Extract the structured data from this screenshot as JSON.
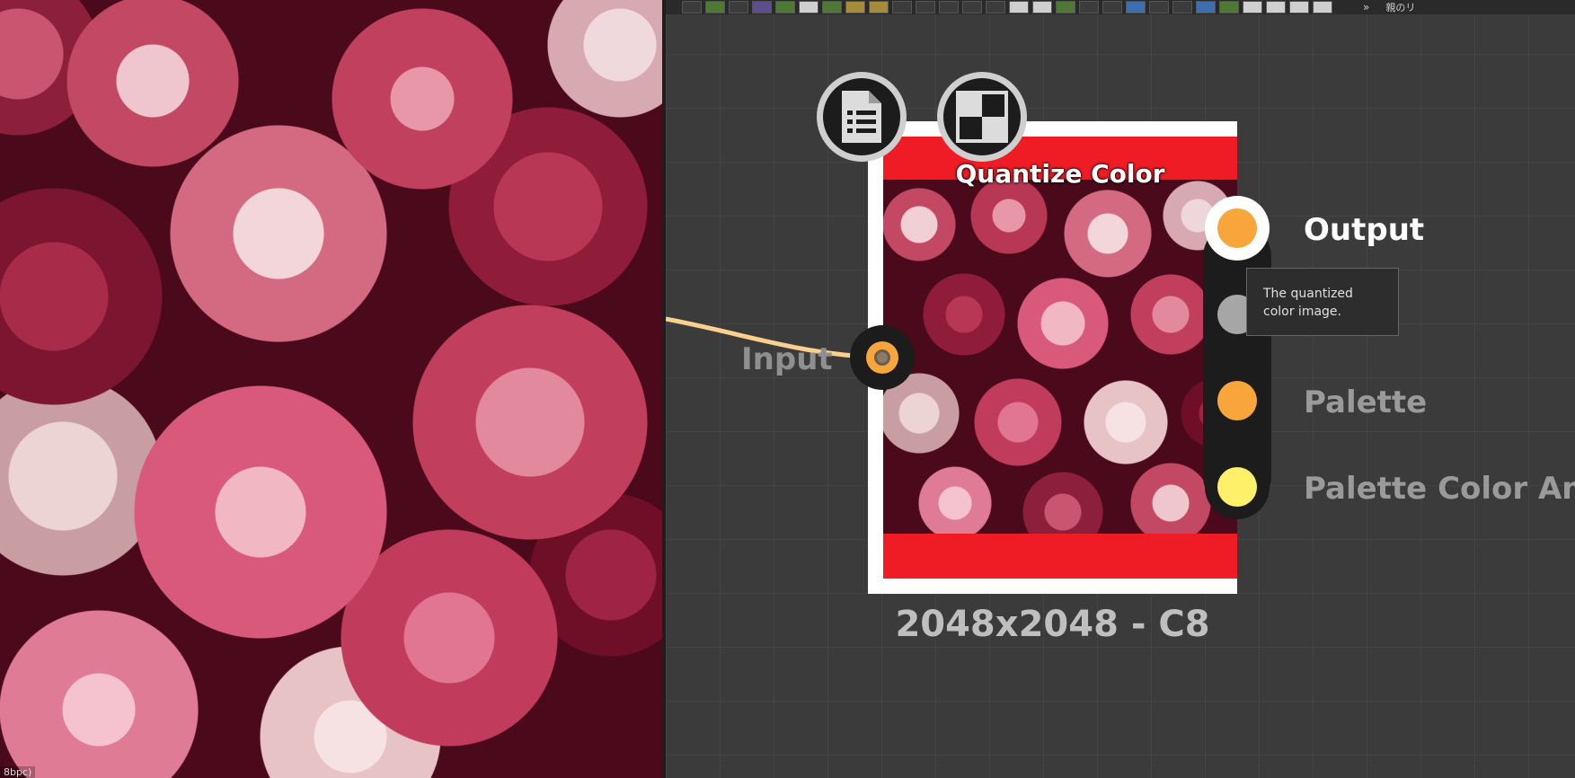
{
  "preview": {
    "status_text": "8bpc)"
  },
  "toolbar": {
    "more": "»",
    "jp_label": "親のリ"
  },
  "node": {
    "title": "Quantize Color",
    "footer": "2048x2048 - C8",
    "inputs": [
      {
        "label": "Input",
        "color": "#f8a63c"
      }
    ],
    "outputs": [
      {
        "label": "Output",
        "color": "#f8a63c"
      },
      {
        "label": "",
        "color": "#a6a6a6"
      },
      {
        "label": "Palette",
        "color": "#f8a63c"
      },
      {
        "label": "Palette Color Amou",
        "color": "#fff06a"
      }
    ],
    "header_color": "#ef1c25",
    "badges": [
      "document-icon",
      "checker-icon"
    ]
  },
  "tooltip": {
    "text": "The quantized color image."
  },
  "wire_color": "#f9d08e"
}
